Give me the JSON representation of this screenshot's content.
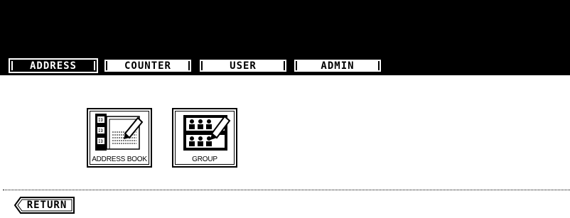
{
  "tabs": [
    {
      "label": "ADDRESS",
      "active": true
    },
    {
      "label": "COUNTER",
      "active": false
    },
    {
      "label": "USER",
      "active": false
    },
    {
      "label": "ADMIN",
      "active": false
    }
  ],
  "buttons": {
    "address_book": {
      "label": "ADDRESS BOOK",
      "icon": "address-book-icon",
      "slots": [
        "ID 001",
        "ID 002",
        "ID 003"
      ]
    },
    "group": {
      "label": "GROUP",
      "icon": "group-icon"
    }
  },
  "return_label": "RETURN",
  "colors": {
    "bar": "#000000",
    "background": "#ffffff"
  }
}
